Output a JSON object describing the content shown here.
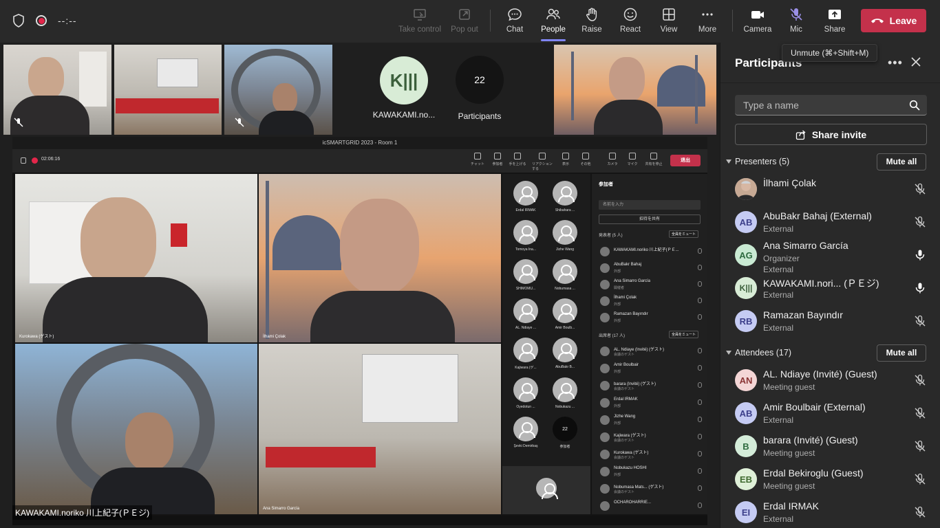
{
  "topbar": {
    "timer": "--:--",
    "buttons": [
      {
        "key": "take_control",
        "label": "Take control"
      },
      {
        "key": "pop_out",
        "label": "Pop out"
      },
      {
        "key": "chat",
        "label": "Chat"
      },
      {
        "key": "people",
        "label": "People"
      },
      {
        "key": "raise",
        "label": "Raise"
      },
      {
        "key": "react",
        "label": "React"
      },
      {
        "key": "view",
        "label": "View"
      },
      {
        "key": "more",
        "label": "More"
      },
      {
        "key": "camera",
        "label": "Camera"
      },
      {
        "key": "mic",
        "label": "Mic"
      },
      {
        "key": "share",
        "label": "Share"
      }
    ],
    "leave_label": "Leave",
    "tooltip": "Unmute (⌘+Shift+M)"
  },
  "thumbs": {
    "avatar_initials": "K|||",
    "avatar_name": "KAWAKAMI.no...",
    "participants_count": "22",
    "participants_label": "Participants"
  },
  "shared": {
    "window_title": "icSMARTGRID 2023 - Room 1",
    "timer": "02:06:16",
    "sharer_name": "KAWAKAMI.noriko 川上紀子(ＰＥジ)",
    "tool_labels": [
      "チャット",
      "参加者",
      "手を上げる",
      "リアクションする",
      "表示",
      "その他",
      "カメラ",
      "マイク",
      "共有を停止"
    ],
    "leave": "退出",
    "video_names": [
      "Kurokawa (ゲスト)",
      "İlhami Çolak",
      "",
      "Ana Simarro García"
    ],
    "gallery": [
      "Erdal IRMAK",
      "Shibahara ...",
      "Tomoya Ina...",
      "Jizhe Wang",
      "SHIMOMU...",
      "Nobumasa ...",
      "AL. Ndiaye ...",
      "Amir Boulb...",
      "Kajiwara (ゲ...",
      "AbuBakr B...",
      "Oyedotun ...",
      "Nobukazu ...",
      "Şevki Demirbaş",
      "参加者"
    ],
    "gallery_count": "22",
    "panel_title": "参加者",
    "panel_search": "名前を入力",
    "panel_invite": "招待を共有",
    "presenters_head": "発表者 (5 人)",
    "attendees_head": "出席者 (17 人)",
    "mute_all": "全員をミュート",
    "panel_rows": [
      {
        "n": "KAWAKAMI.noriko 川上紀子(ＰＥ...",
        "r": ""
      },
      {
        "n": "AbuBakr Bahaj",
        "r": "外部"
      },
      {
        "n": "Ana Simarro García",
        "r": "開催者"
      },
      {
        "n": "İlhami Çolak",
        "r": "外部"
      },
      {
        "n": "Ramazan Bayındır",
        "r": "外部"
      },
      {
        "n": "AL. Ndiaye (Invité) (ゲスト)",
        "r": "会議のゲスト"
      },
      {
        "n": "Amir Boulbair",
        "r": "外部"
      },
      {
        "n": "barara (Invité) (ゲスト)",
        "r": "会議のゲスト"
      },
      {
        "n": "Erdal IRMAK",
        "r": "外部"
      },
      {
        "n": "Jizhe Wang",
        "r": "外部"
      },
      {
        "n": "Kajiwara (ゲスト)",
        "r": "会議のゲスト"
      },
      {
        "n": "Kurokawa (ゲスト)",
        "r": "会議のゲスト"
      },
      {
        "n": "Nobukazu HOSHI",
        "r": "外部"
      },
      {
        "n": "Nobumasa Mats... (ゲスト)",
        "r": "会議のゲスト"
      },
      {
        "n": "OCHAROHARRIE...",
        "r": ""
      }
    ]
  },
  "panel": {
    "title": "Participants",
    "search_placeholder": "Type a name",
    "share_invite": "Share invite",
    "presenters_header": "Presenters (5)",
    "attendees_header": "Attendees (17)",
    "mute_all": "Mute all",
    "presenters": [
      {
        "initials": "",
        "name": "İlhami Çolak",
        "role": "",
        "role2": "",
        "avatar_bg": "#8a8f99",
        "mic": "muted"
      },
      {
        "initials": "AB",
        "name": "AbuBakr Bahaj (External)",
        "role": "External",
        "role2": "",
        "avatar_bg": "#c5cbf3",
        "mic": "muted"
      },
      {
        "initials": "AG",
        "name": "Ana Simarro García",
        "role": "Organizer",
        "role2": "External",
        "avatar_bg": "#c9ead3",
        "mic": "on"
      },
      {
        "initials": "K|||",
        "name": "KAWAKAMI.nori... (ＰＥジ)",
        "role": "External",
        "role2": "",
        "avatar_bg": "#d8ecd6",
        "mic": "on"
      },
      {
        "initials": "RB",
        "name": "Ramazan Bayındır",
        "role": "External",
        "role2": "",
        "avatar_bg": "#c5cbf3",
        "mic": "muted"
      }
    ],
    "attendees": [
      {
        "initials": "AN",
        "name": "AL. Ndiaye (Invité) (Guest)",
        "role": "Meeting guest",
        "avatar_bg": "#f4d6d6",
        "mic": "muted"
      },
      {
        "initials": "AB",
        "name": "Amir Boulbair (External)",
        "role": "External",
        "avatar_bg": "#c5cbf3",
        "mic": "muted"
      },
      {
        "initials": "B",
        "name": "barara (Invité) (Guest)",
        "role": "Meeting guest",
        "avatar_bg": "#d4ecd9",
        "mic": "muted"
      },
      {
        "initials": "EB",
        "name": "Erdal Bekiroglu (Guest)",
        "role": "Meeting guest",
        "avatar_bg": "#dff0d8",
        "mic": "muted"
      },
      {
        "initials": "EI",
        "name": "Erdal IRMAK",
        "role": "External",
        "avatar_bg": "#c5cbf3",
        "mic": "muted"
      }
    ]
  },
  "colors": {
    "accent": "#7f85f5",
    "leave": "#c4314b",
    "panel_bg": "#292929"
  }
}
